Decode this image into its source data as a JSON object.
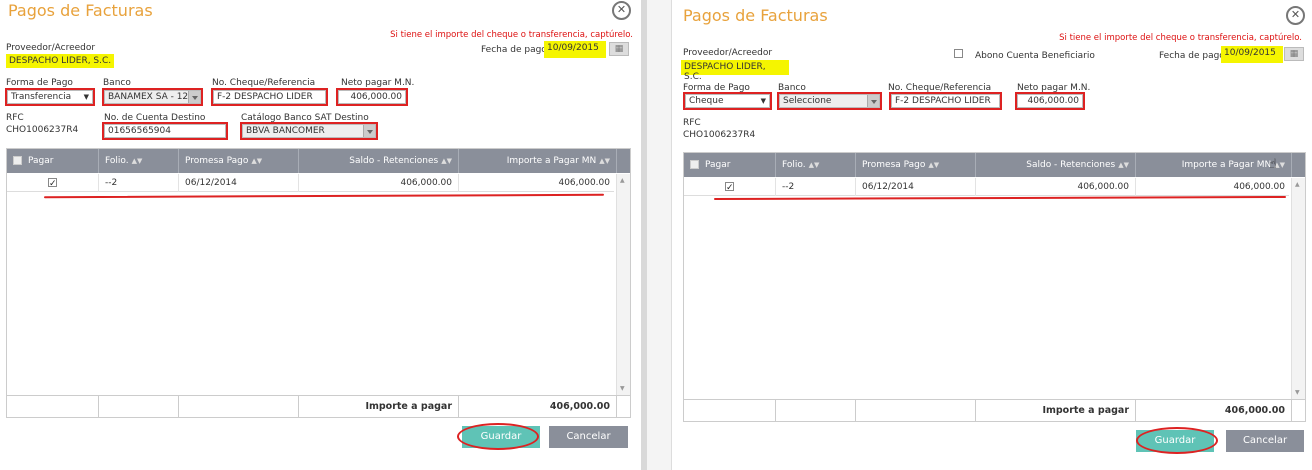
{
  "left": {
    "title": "Pagos de Facturas",
    "hint": "Si tiene el importe del cheque o transferencia, captúrelo.",
    "proveedor_label": "Proveedor/Acreedor",
    "proveedor_value": "DESPACHO LIDER, S.C.",
    "fecha_label": "Fecha de pago",
    "fecha_value": "10/09/2015",
    "forma_label": "Forma de Pago",
    "forma_value": "Transferencia",
    "banco_label": "Banco",
    "banco_value": "BANAMEX SA - 12...",
    "cheque_label": "No. Cheque/Referencia",
    "cheque_value": "F-2 DESPACHO LIDER",
    "neto_label": "Neto pagar M.N.",
    "neto_value": "406,000.00",
    "rfc_label": "RFC",
    "rfc_value": "CHO1006237R4",
    "cuenta_label": "No. de Cuenta Destino",
    "cuenta_value": "01656565904",
    "catalogo_label": "Catálogo Banco SAT Destino",
    "catalogo_value": "BBVA BANCOMER",
    "columns": [
      "Pagar",
      "Folio.",
      "Promesa Pago",
      "Saldo - Retenciones",
      "Importe a Pagar MN"
    ],
    "rows": [
      {
        "folio": "--2",
        "promesa": "06/12/2014",
        "saldo": "406,000.00",
        "importe": "406,000.00"
      }
    ],
    "total_label": "Importe a pagar",
    "total_value": "406,000.00",
    "save_label": "Guardar",
    "cancel_label": "Cancelar"
  },
  "right": {
    "title": "Pagos de Facturas",
    "hint": "Si tiene el importe del cheque o transferencia, captúrelo.",
    "proveedor_label": "Proveedor/Acreedor",
    "proveedor_value": "DESPACHO LIDER, S.C.",
    "abono_label": "Abono Cuenta Beneficiario",
    "fecha_label": "Fecha de pago",
    "fecha_value": "10/09/2015",
    "forma_label": "Forma de Pago",
    "forma_value": "Cheque",
    "banco_label": "Banco",
    "banco_value": "Seleccione",
    "cheque_label": "No. Cheque/Referencia",
    "cheque_value": "F-2 DESPACHO LIDER",
    "neto_label": "Neto pagar M.N.",
    "neto_value": "406,000.00",
    "rfc_label": "RFC",
    "rfc_value": "CHO1006237R4",
    "columns": [
      "Pagar",
      "Folio.",
      "Promesa Pago",
      "Saldo - Retenciones",
      "Importe a Pagar MN"
    ],
    "rows": [
      {
        "folio": "--2",
        "promesa": "06/12/2014",
        "saldo": "406,000.00",
        "importe": "406,000.00"
      }
    ],
    "total_label": "Importe a pagar",
    "total_value": "406,000.00",
    "save_label": "Guardar",
    "cancel_label": "Cancelar"
  },
  "colors": {
    "title": "#e8a23c",
    "hint": "#dd1111",
    "highlight": "#f5f500",
    "annotation": "#dd2222",
    "save_button": "#5fc3b6",
    "cancel_button": "#8a8f9a",
    "grid_header": "#8a8f9a"
  },
  "icons": [
    "close-icon",
    "calendar-icon",
    "sort-icon",
    "checkbox-icon",
    "dropdown-arrow-icon",
    "hand-cursor-icon"
  ]
}
